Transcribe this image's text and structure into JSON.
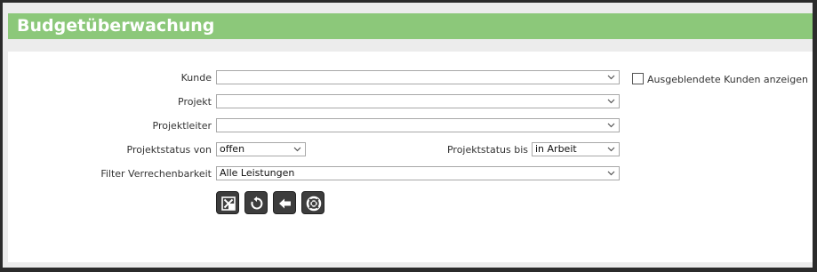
{
  "page": {
    "title": "Budgetüberwachung"
  },
  "form": {
    "kunde_label": "Kunde",
    "kunde_value": "",
    "hidden_customers_label": "Ausgeblendete Kunden anzeigen",
    "projekt_label": "Projekt",
    "projekt_value": "",
    "projektleiter_label": "Projektleiter",
    "projektleiter_value": "",
    "status_von_label": "Projektstatus von",
    "status_von_value": "offen",
    "status_bis_label": "Projektstatus bis",
    "status_bis_value": "in Arbeit",
    "filter_label": "Filter Verrechenbarkeit",
    "filter_value": "Alle Leistungen"
  },
  "toolbar": {
    "buttons": [
      {
        "icon": "excel-export-icon"
      },
      {
        "icon": "refresh-icon"
      },
      {
        "icon": "back-arrow-icon"
      },
      {
        "icon": "help-lifebuoy-icon"
      }
    ]
  },
  "colors": {
    "titlebar": "#8cc87a",
    "button": "#3d3d3d"
  }
}
